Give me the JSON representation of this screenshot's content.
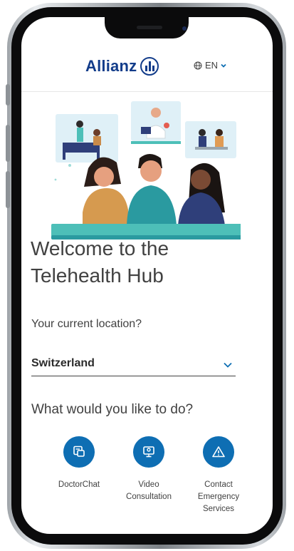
{
  "header": {
    "brand": "Allianz",
    "language": "EN"
  },
  "hero": {
    "title_line1": "Welcome to the",
    "title_line2": "Telehealth Hub"
  },
  "location": {
    "label": "Your current location?",
    "value": "Switzerland"
  },
  "actions": {
    "question": "What would you like to do?",
    "items": [
      {
        "label_line1": "DoctorChat",
        "label_line2": "",
        "label_line3": "",
        "icon": "chat-icon"
      },
      {
        "label_line1": "Video",
        "label_line2": "Consultation",
        "label_line3": "",
        "icon": "video-call-icon"
      },
      {
        "label_line1": "Contact",
        "label_line2": "Emergency",
        "label_line3": "Services",
        "icon": "warning-icon"
      }
    ]
  },
  "colors": {
    "brand_blue": "#123c8a",
    "action_blue": "#0e6eb3",
    "teal": "#4dbfb8",
    "text": "#414141"
  }
}
